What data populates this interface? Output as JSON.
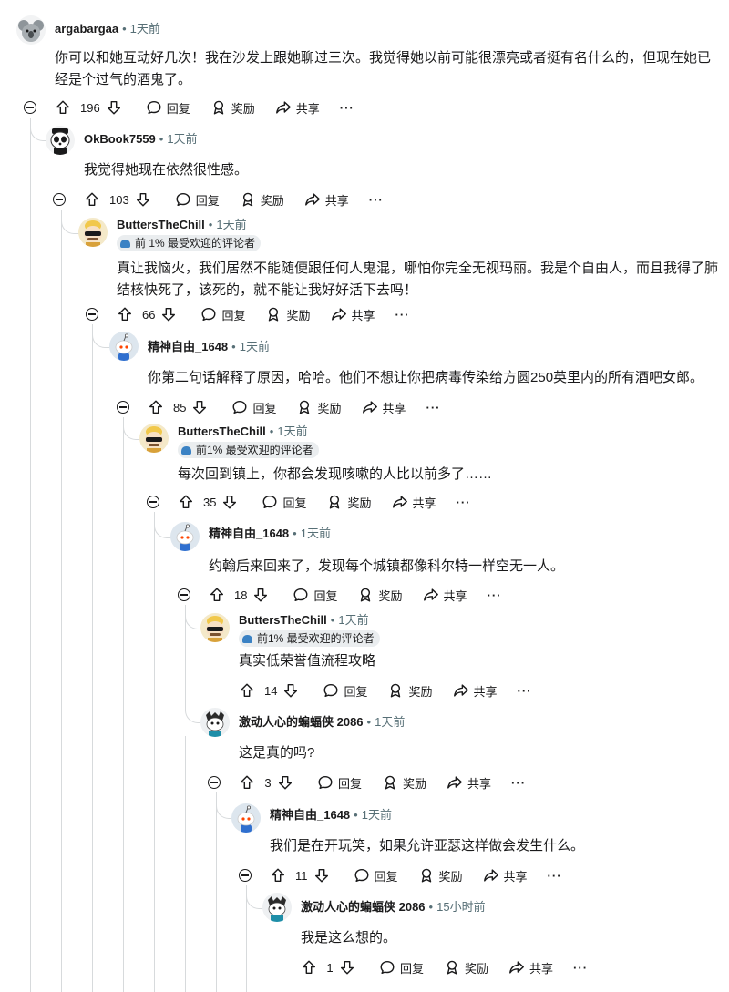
{
  "flair_text_a": "前 1% 最受欢迎的评论者",
  "flair_text_b": "前1% 最受欢迎的评论者",
  "actions": {
    "reply": "回复",
    "award": "奖励",
    "share": "共享",
    "more": "···"
  },
  "comments": [
    {
      "user": "argabargaa",
      "time": "1天前",
      "body": "你可以和她互动好几次！我在沙发上跟她聊过三次。我觉得她以前可能很漂亮或者挺有名什么的，但现在她已\n经是个过气的酒鬼了。",
      "score": "196",
      "avatar": "koala"
    },
    {
      "user": "OkBook7559",
      "time": "1天前",
      "body": "我觉得她现在依然很性感。",
      "score": "103",
      "avatar": "panda"
    },
    {
      "user": "ButtersTheChill",
      "time": "1天前",
      "flair": "前 1% 最受欢迎的评论者",
      "body": "真让我恼火，我们居然不能随便跟任何人鬼混，哪怕你完全无视玛丽。我是个自由人，而且我得了肺\n结核快死了，该死的，就不能让我好好活下去吗！",
      "score": "66",
      "avatar": "butters"
    },
    {
      "user": "精神自由_1648",
      "time": "1天前",
      "body": "你第二句话解释了原因，哈哈。他们不想让你把病毒传染给方圆250英里内的所有酒吧女郎。",
      "score": "85",
      "avatar": "snoo"
    },
    {
      "user": "ButtersTheChill",
      "time": "1天前",
      "flair": "前1% 最受欢迎的评论者",
      "body": "每次回到镇上，你都会发现咳嗽的人比以前多了……",
      "score": "35",
      "avatar": "butters"
    },
    {
      "user": "精神自由_1648",
      "time": "1天前",
      "body": "约翰后来回来了，发现每个城镇都像科尔特一样空无一人。",
      "score": "18",
      "avatar": "snoo"
    },
    {
      "user": "ButtersTheChill",
      "time": "1天前",
      "flair": "前1% 最受欢迎的评论者",
      "body": "真实低荣誉值流程攻略",
      "score": "14",
      "avatar": "butters"
    },
    {
      "user": "激动人心的蝙蝠侠 2086",
      "time": "1天前",
      "body": "这是真的吗?",
      "score": "3",
      "avatar": "bat"
    },
    {
      "user": "精神自由_1648",
      "time": "1天前",
      "body": "我们是在开玩笑，如果允许亚瑟这样做会发生什么。",
      "score": "11",
      "avatar": "snoo"
    },
    {
      "user": "激动人心的蝙蝠侠 2086",
      "time": "15小时前",
      "body": "我是这么想的。",
      "score": "1",
      "avatar": "bat"
    }
  ]
}
